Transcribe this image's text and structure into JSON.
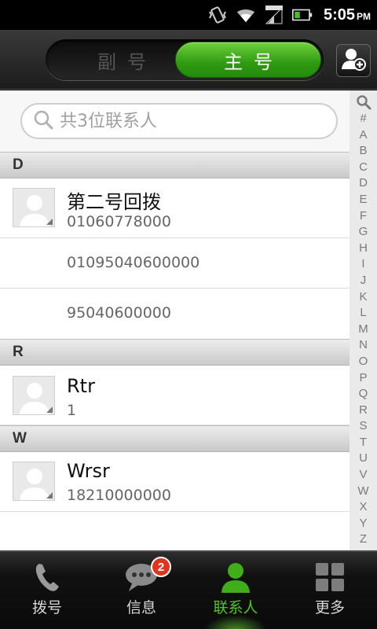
{
  "status_bar": {
    "icons": [
      "vibrate-icon",
      "wifi-icon",
      "network-3g-icon",
      "battery-icon"
    ],
    "time": "5:05",
    "ampm": "PM"
  },
  "header": {
    "tabs": [
      {
        "label": "副号",
        "selected": false
      },
      {
        "label": "主号",
        "selected": true
      }
    ],
    "accent_color": "#3da517",
    "add_contact_icon": "add-contact-icon"
  },
  "search": {
    "placeholder": "共3位联系人",
    "icon": "search-icon"
  },
  "sections": [
    {
      "letter": "D",
      "contacts": [
        {
          "name": "第二号回拨",
          "phones": [
            "01060778000",
            "01095040600000",
            "95040600000"
          ]
        }
      ]
    },
    {
      "letter": "R",
      "contacts": [
        {
          "name": "Rtr",
          "phones": [
            "1"
          ]
        }
      ]
    },
    {
      "letter": "W",
      "contacts": [
        {
          "name": "Wrsr",
          "phones": [
            "18210000000"
          ]
        }
      ]
    }
  ],
  "index_bar": [
    "#",
    "A",
    "B",
    "C",
    "D",
    "E",
    "F",
    "G",
    "H",
    "I",
    "J",
    "K",
    "L",
    "M",
    "N",
    "O",
    "P",
    "Q",
    "R",
    "S",
    "T",
    "U",
    "V",
    "W",
    "X",
    "Y",
    "Z"
  ],
  "bottom_nav": [
    {
      "label": "拨号",
      "icon": "phone-icon",
      "active": false
    },
    {
      "label": "信息",
      "icon": "message-icon",
      "active": false,
      "badge": "2"
    },
    {
      "label": "联系人",
      "icon": "contacts-icon",
      "active": true
    },
    {
      "label": "更多",
      "icon": "grid-icon",
      "active": false
    }
  ]
}
